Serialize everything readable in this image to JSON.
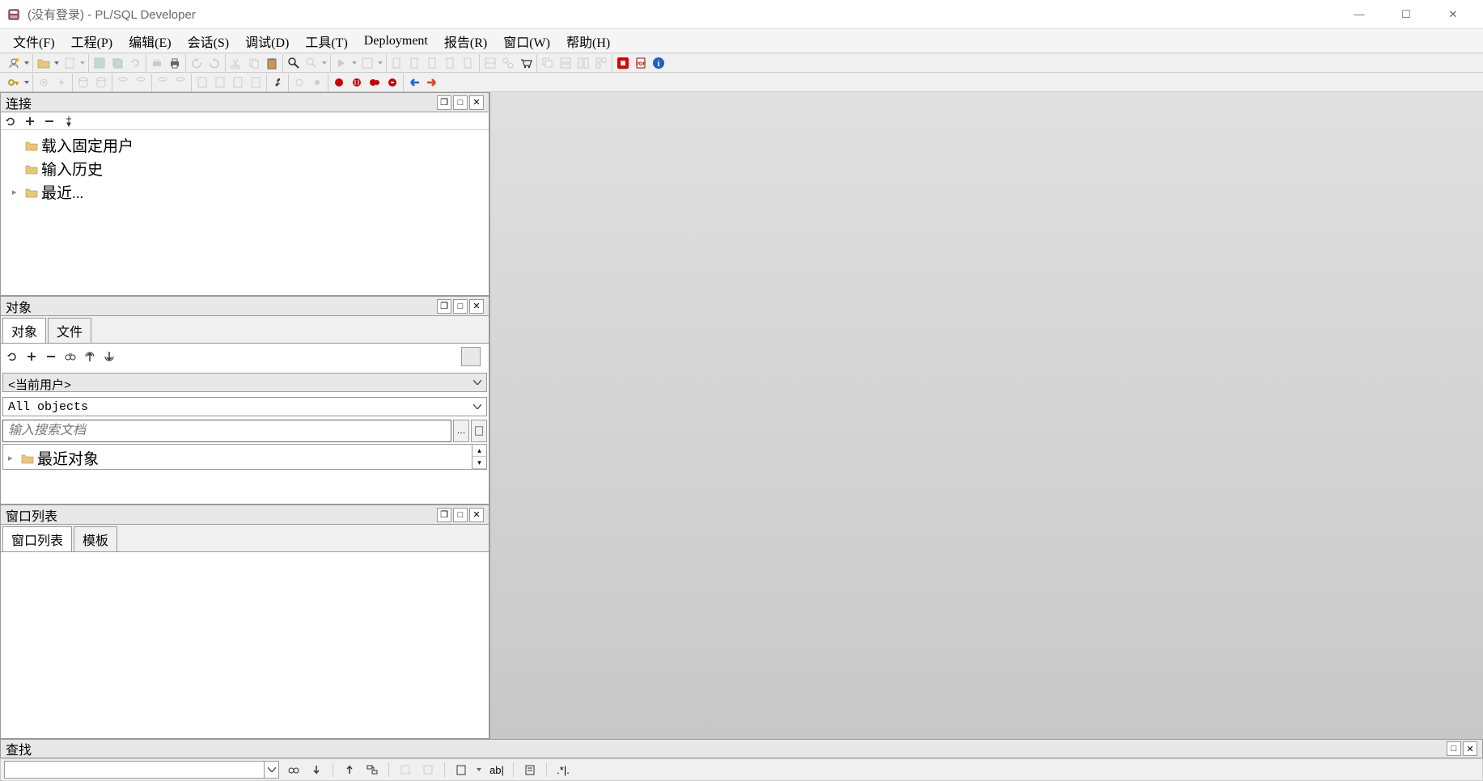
{
  "window": {
    "title": "(没有登录) - PL/SQL Developer",
    "controls": {
      "min": "—",
      "max": "☐",
      "close": "✕"
    }
  },
  "menubar": [
    "文件(F)",
    "工程(P)",
    "编辑(E)",
    "会话(S)",
    "调试(D)",
    "工具(T)",
    "Deployment",
    "报告(R)",
    "窗口(W)",
    "帮助(H)"
  ],
  "panels": {
    "connections": {
      "title": "连接",
      "items": [
        "载入固定用户",
        "输入历史",
        "最近..."
      ]
    },
    "objects": {
      "title": "对象",
      "tabs": [
        "对象",
        "文件"
      ],
      "user_combo": "<当前用户>",
      "filter_combo": "All objects",
      "search_placeholder": "输入搜索文档",
      "tree_root": "最近对象"
    },
    "windowlist": {
      "title": "窗口列表",
      "tabs": [
        "窗口列表",
        "模板"
      ]
    },
    "search": {
      "title": "查找"
    }
  },
  "panel_ctrl": {
    "restore": "❐",
    "max": "□",
    "close": "✕"
  }
}
